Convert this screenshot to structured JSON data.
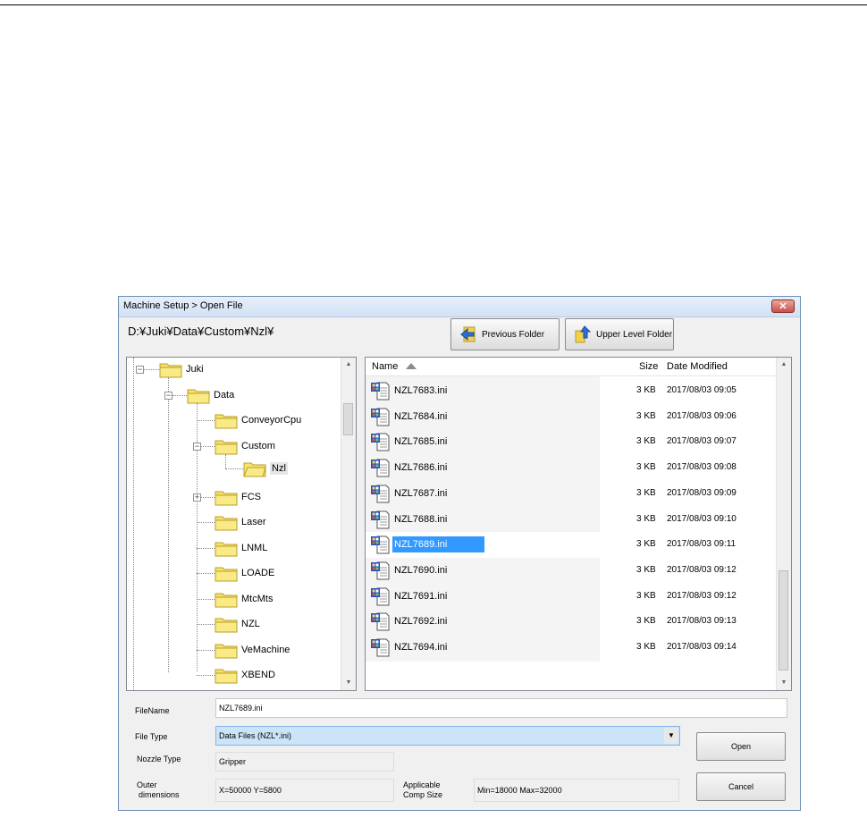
{
  "window": {
    "title": "Machine Setup > Open File",
    "close_glyph": "✕"
  },
  "path": "D:¥Juki¥Data¥Custom¥Nzl¥",
  "toolbar": {
    "previous_label": "Previous Folder",
    "upper_label": "Upper Level Folder"
  },
  "tree": {
    "items": [
      {
        "label": "Juki"
      },
      {
        "label": "Data"
      },
      {
        "label": "ConveyorCpu"
      },
      {
        "label": "Custom"
      },
      {
        "label": "Nzl"
      },
      {
        "label": "FCS"
      },
      {
        "label": "Laser"
      },
      {
        "label": "LNML"
      },
      {
        "label": "LOADE"
      },
      {
        "label": "MtcMts"
      },
      {
        "label": "NZL"
      },
      {
        "label": "VeMachine"
      },
      {
        "label": "XBEND"
      }
    ]
  },
  "list": {
    "columns": {
      "name": "Name",
      "size": "Size",
      "date": "Date Modified"
    },
    "rows": [
      {
        "name": "NZL7683.ini",
        "size": "3 KB",
        "date": "2017/08/03 09:05"
      },
      {
        "name": "NZL7684.ini",
        "size": "3 KB",
        "date": "2017/08/03 09:06"
      },
      {
        "name": "NZL7685.ini",
        "size": "3 KB",
        "date": "2017/08/03 09:07"
      },
      {
        "name": "NZL7686.ini",
        "size": "3 KB",
        "date": "2017/08/03 09:08"
      },
      {
        "name": "NZL7687.ini",
        "size": "3 KB",
        "date": "2017/08/03 09:09"
      },
      {
        "name": "NZL7688.ini",
        "size": "3 KB",
        "date": "2017/08/03 09:10"
      },
      {
        "name": "NZL7689.ini",
        "size": "3 KB",
        "date": "2017/08/03 09:11"
      },
      {
        "name": "NZL7690.ini",
        "size": "3 KB",
        "date": "2017/08/03 09:12"
      },
      {
        "name": "NZL7691.ini",
        "size": "3 KB",
        "date": "2017/08/03 09:12"
      },
      {
        "name": "NZL7692.ini",
        "size": "3 KB",
        "date": "2017/08/03 09:13"
      },
      {
        "name": "NZL7694.ini",
        "size": "3 KB",
        "date": "2017/08/03 09:14"
      }
    ]
  },
  "form": {
    "filename_label": "FileName",
    "filename_value": "NZL7689.ini",
    "filetype_label": "File Type",
    "filetype_value": "Data Files (NZL*.ini)",
    "nozzle_label": "Nozzle Type",
    "nozzle_value": "Gripper",
    "outer_label_1": "Outer",
    "outer_label_2": "dimensions",
    "outer_value": "X=50000 Y=5800",
    "comp_label_1": "Applicable",
    "comp_label_2": "Comp Size",
    "comp_value": "Min=18000 Max=32000",
    "open_label": "Open",
    "cancel_label": "Cancel"
  },
  "colors": {
    "selection": "#3399ff",
    "select_bg": "#cce4f7",
    "folder": "#f7e36a"
  }
}
